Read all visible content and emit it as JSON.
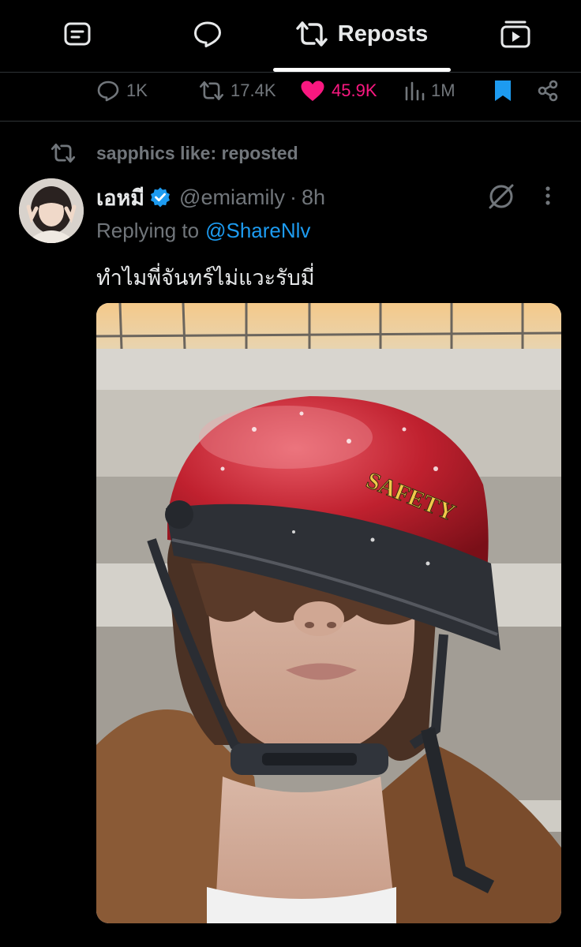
{
  "tabs": [
    {
      "icon": "article-icon"
    },
    {
      "icon": "speech-bubble-icon"
    },
    {
      "icon": "repost-icon",
      "label": "Reposts",
      "active": true
    },
    {
      "icon": "media-play-icon"
    }
  ],
  "stats": {
    "replies": "1K",
    "reposts": "17.4K",
    "likes": "45.9K",
    "views": "1M"
  },
  "repost_header": {
    "text": "sapphics like: reposted"
  },
  "tweet": {
    "name": "เอหมี",
    "verified": true,
    "handle": "@emiamily",
    "separator": "·",
    "time": "8h",
    "replying_label": "Replying to",
    "replying_to": "@ShareNlv",
    "text": "ทำไมพี่จันทร์ไม่แวะรับมี่",
    "helmet_text": "SAFETY"
  },
  "colors": {
    "background": "#000000",
    "text_primary": "#e7e9ea",
    "text_secondary": "#71767b",
    "accent_blue": "#1d9bf0",
    "like_pink": "#f91880"
  }
}
